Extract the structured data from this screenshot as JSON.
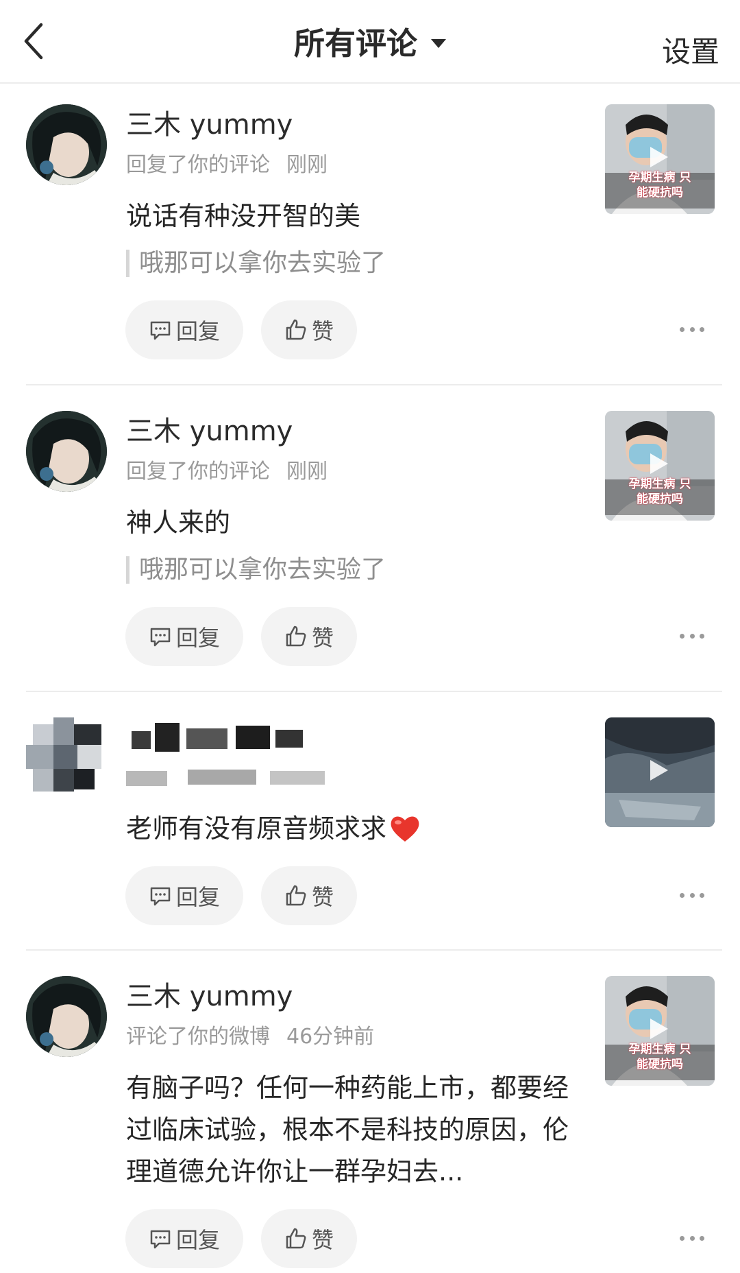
{
  "header": {
    "title": "所有评论",
    "settings_label": "设置"
  },
  "actions": {
    "reply_label": "回复",
    "like_label": "赞"
  },
  "comments": [
    {
      "username": "三木 yummy",
      "action": "回复了你的评论",
      "time": "刚刚",
      "content": "说话有种没开智的美",
      "quote": "哦那可以拿你去实验了",
      "thumbnail_caption": "孕期生病 只能硬抗吗",
      "avatar": "anime-avatar"
    },
    {
      "username": "三木 yummy",
      "action": "回复了你的评论",
      "time": "刚刚",
      "content": "神人来的",
      "quote": "哦那可以拿你去实验了",
      "thumbnail_caption": "孕期生病 只能硬抗吗",
      "avatar": "anime-avatar"
    },
    {
      "username": "",
      "action": "",
      "time": "",
      "content": "老师有没有原音频求求",
      "quote": "",
      "thumbnail_caption": "",
      "avatar": "pixelated-avatar",
      "emoji": "heart-icon"
    },
    {
      "username": "三木 yummy",
      "action": "评论了你的微博",
      "time": "46分钟前",
      "content": "有脑子吗？任何一种药能上市，都要经过临床试验，根本不是科技的原因，伦理道德允许你让一群孕妇去...",
      "quote": "",
      "thumbnail_caption": "孕期生病 只能硬抗吗",
      "avatar": "anime-avatar"
    }
  ],
  "colors": {
    "accent_text": "#1f1f1f",
    "meta_text": "#9a9a9a",
    "pill_bg": "#f3f3f3",
    "heart": "#e8352c"
  }
}
